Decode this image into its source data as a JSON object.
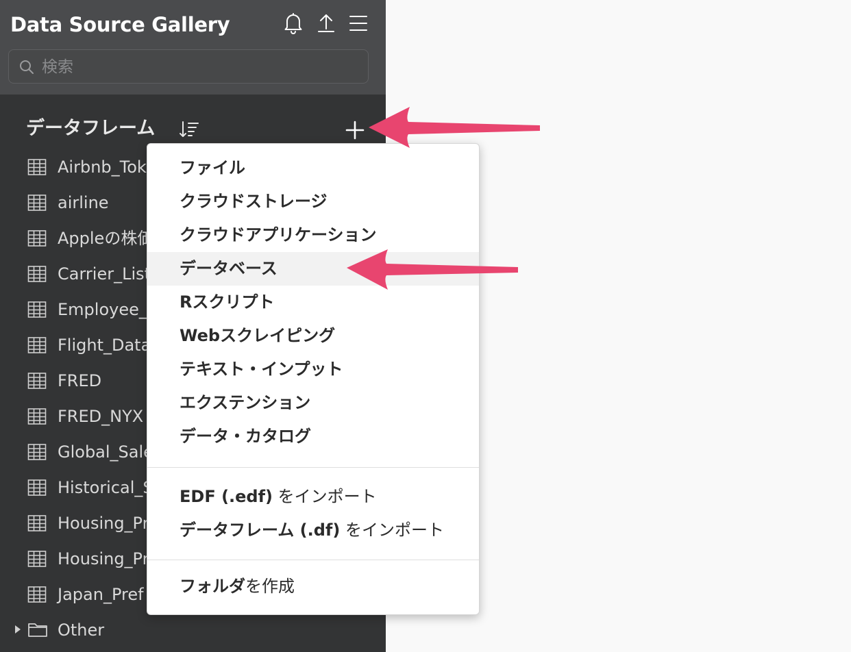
{
  "app": {
    "title": "Data Source Gallery"
  },
  "toolbar": {
    "icons": [
      "bell-icon",
      "upload-icon",
      "hamburger-menu-icon"
    ]
  },
  "search": {
    "placeholder": "検索"
  },
  "section": {
    "title": "データフレーム"
  },
  "dataframes": [
    {
      "label": "Airbnb_Tok"
    },
    {
      "label": "airline"
    },
    {
      "label": "Appleの株価"
    },
    {
      "label": "Carrier_List"
    },
    {
      "label": "Employee_"
    },
    {
      "label": "Flight_Data"
    },
    {
      "label": "FRED"
    },
    {
      "label": "FRED_NYX"
    },
    {
      "label": "Global_Sale"
    },
    {
      "label": "Historical_S"
    },
    {
      "label": "Housing_Pr"
    },
    {
      "label": "Housing_Pr"
    },
    {
      "label": "Japan_Pref"
    }
  ],
  "folder": {
    "label": "Other"
  },
  "menu": {
    "sources": [
      {
        "bold": "ファイル",
        "normal": ""
      },
      {
        "bold": "クラウドストレージ",
        "normal": ""
      },
      {
        "bold": "クラウドアプリケーション",
        "normal": ""
      },
      {
        "bold": "データベース",
        "normal": "",
        "highlighted": true
      },
      {
        "bold": "Rスクリプト",
        "normal": ""
      },
      {
        "bold": "Webスクレイピング",
        "normal": ""
      },
      {
        "bold": "テキスト・インプット",
        "normal": ""
      },
      {
        "bold": "エクステンション",
        "normal": ""
      },
      {
        "bold": "データ・カタログ",
        "normal": ""
      }
    ],
    "imports": [
      {
        "bold": "EDF (.edf)",
        "normal": " をインポート"
      },
      {
        "bold": "データフレーム (.df)",
        "normal": " をインポート"
      }
    ],
    "create": [
      {
        "bold": "フォルダ",
        "normal": "を作成"
      }
    ]
  },
  "colors": {
    "sidebar_bg": "#333435",
    "topbar_bg": "#4a4b4d",
    "menu_highlight": "#f2f2f2",
    "annotation_arrow": "#e8456f"
  }
}
